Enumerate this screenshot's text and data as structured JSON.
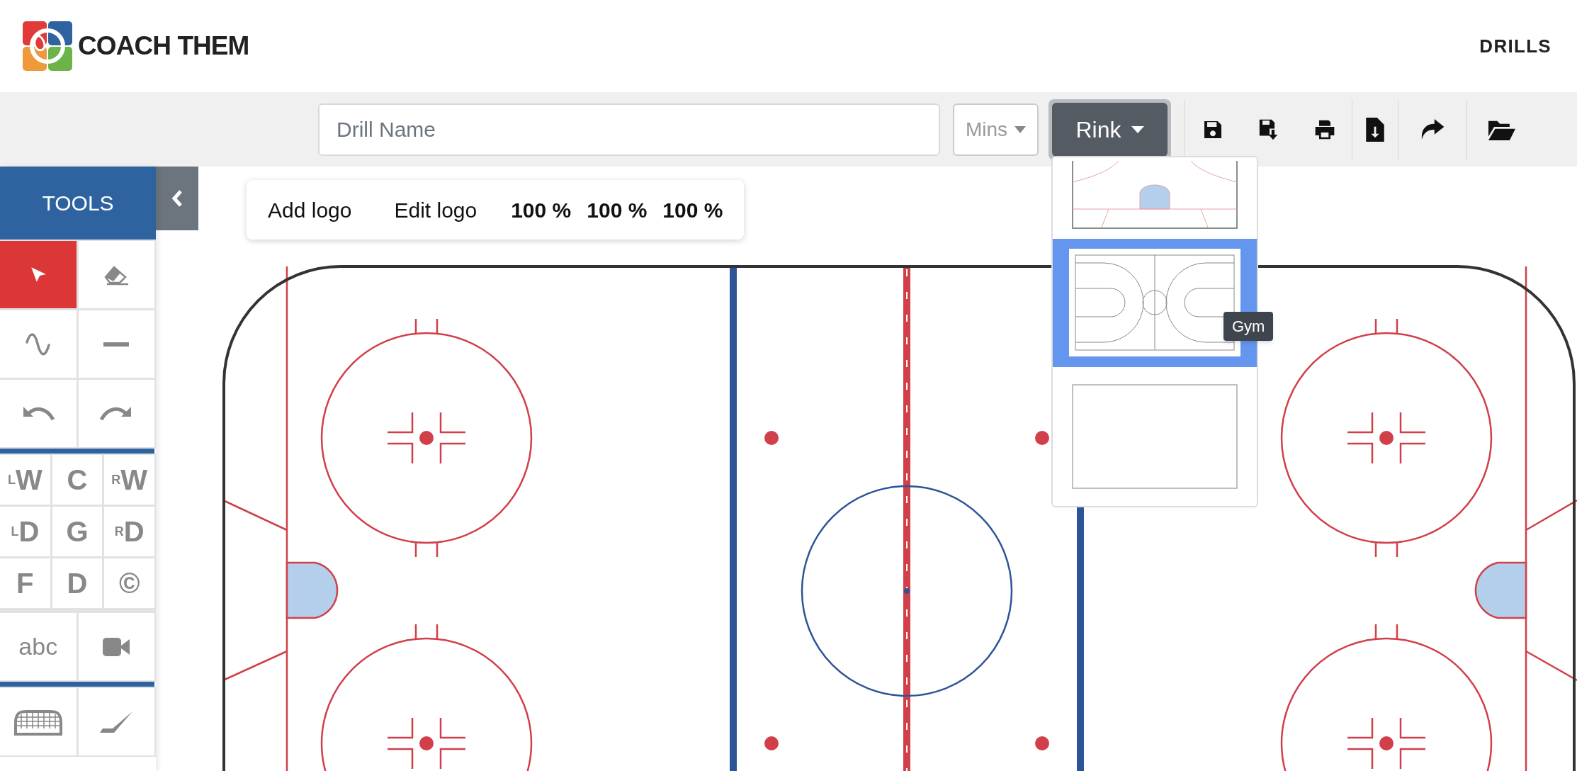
{
  "header": {
    "brand": "COACH THEM",
    "nav": [
      {
        "label": "DRILLS"
      }
    ]
  },
  "toolbar": {
    "drill_name": {
      "placeholder": "Drill Name"
    },
    "duration": {
      "placeholder": "Mins"
    },
    "surface_button": {
      "label": "Rink"
    }
  },
  "sidebar": {
    "title": "TOOLS",
    "drawing_tools": [
      {
        "kind": "pointer",
        "selected": true
      },
      {
        "kind": "eraser",
        "selected": false
      },
      {
        "kind": "curve",
        "selected": false
      },
      {
        "kind": "line",
        "selected": false
      },
      {
        "kind": "undo",
        "selected": false
      },
      {
        "kind": "redo",
        "selected": false
      }
    ],
    "player_tools": [
      {
        "kind": "label",
        "label": "$_{L}$W",
        "selected": false
      },
      {
        "kind": "label",
        "label": "C",
        "selected": false
      },
      {
        "kind": "label",
        "label": "$_{R}$W",
        "selected": false
      },
      {
        "kind": "label",
        "label": "$_{L}$D",
        "selected": false
      },
      {
        "kind": "label",
        "label": "G",
        "selected": false
      },
      {
        "kind": "label",
        "label": "$_{R}$D",
        "selected": false
      },
      {
        "kind": "label",
        "label": "F",
        "selected": false
      },
      {
        "kind": "label",
        "label": "D",
        "selected": false
      },
      {
        "kind": "label",
        "label": "©",
        "selected": false
      }
    ],
    "media_tools": [
      {
        "kind": "text",
        "label": "abc",
        "selected": false
      },
      {
        "kind": "video",
        "selected": false
      }
    ],
    "equipment_tools": [
      {
        "kind": "goal",
        "selected": false
      },
      {
        "kind": "stick",
        "selected": false
      }
    ]
  },
  "logo_bar": {
    "add_logo": "Add logo",
    "edit_logo": "Edit logo",
    "scales": [
      "100 %",
      "100 %",
      "100 %"
    ]
  },
  "surface_menu": {
    "items": [
      {
        "kind": "rink",
        "selected": false
      },
      {
        "kind": "gym",
        "selected": true
      },
      {
        "kind": "blank",
        "selected": false
      }
    ],
    "tooltip": "Gym"
  }
}
